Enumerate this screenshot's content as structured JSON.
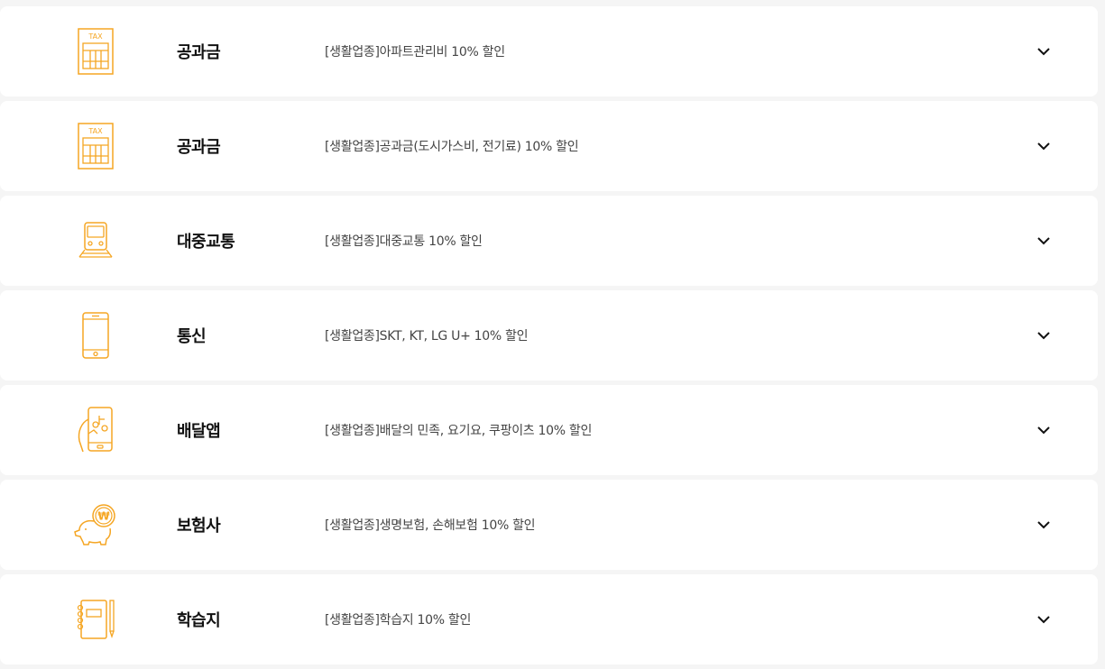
{
  "accent_color": "#f5a623",
  "items": [
    {
      "icon": "tax-bill-icon",
      "category": "공과금",
      "description": "[생활업종]아파트관리비 10% 할인"
    },
    {
      "icon": "tax-bill-icon",
      "category": "공과금",
      "description": "[생활업종]공과금(도시가스비, 전기료) 10% 할인"
    },
    {
      "icon": "train-icon",
      "category": "대중교통",
      "description": "[생활업종]대중교통 10% 할인"
    },
    {
      "icon": "smartphone-icon",
      "category": "통신",
      "description": "[생활업종]SKT, KT, LG U+ 10% 할인"
    },
    {
      "icon": "delivery-app-icon",
      "category": "배달앱",
      "description": "[생활업종]배달의 민족, 요기요, 쿠팡이츠 10% 할인"
    },
    {
      "icon": "piggy-bank-icon",
      "category": "보험사",
      "description": "[생활업종]생명보험, 손해보험 10% 할인"
    },
    {
      "icon": "notebook-icon",
      "category": "학습지",
      "description": "[생활업종]학습지 10% 할인"
    }
  ],
  "tax_label": "TAX",
  "won_symbol": "₩"
}
